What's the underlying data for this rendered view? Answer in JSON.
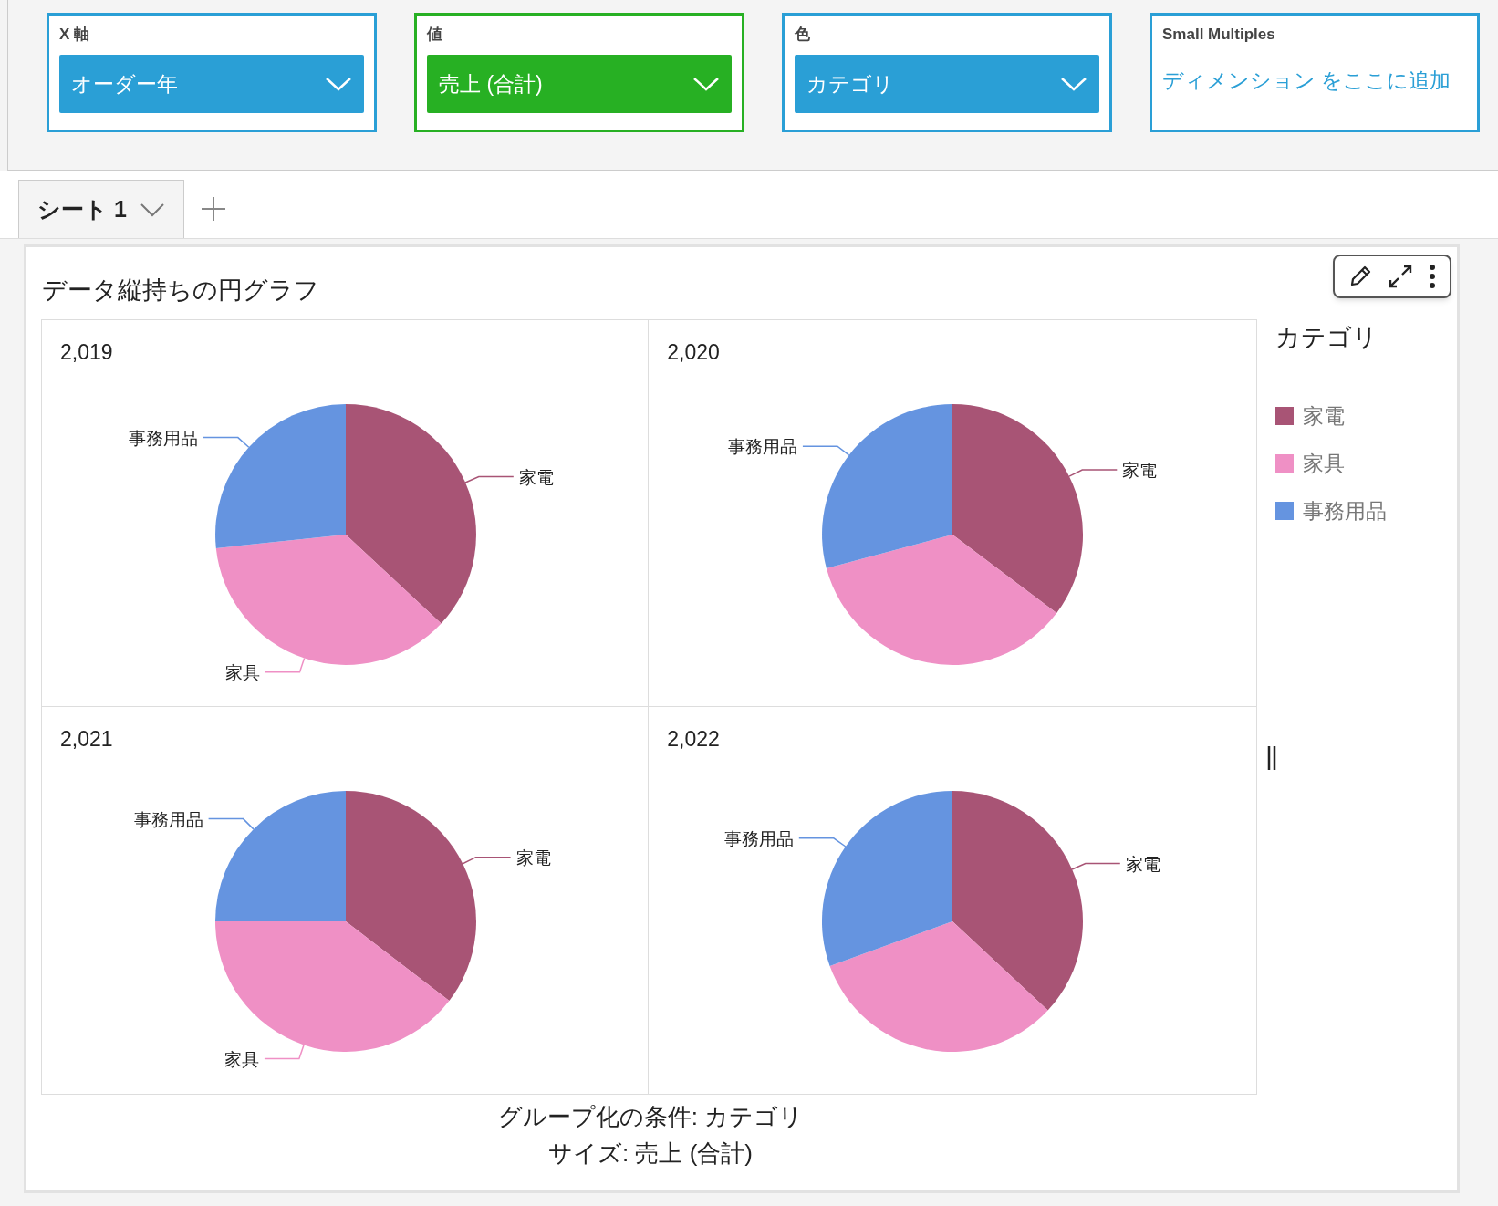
{
  "field_wells": [
    {
      "label": "X 軸",
      "kind": "dropdown",
      "value": "オーダー年",
      "color": "#2a9fd6"
    },
    {
      "label": "値",
      "kind": "dropdown",
      "value": "売上 (合計)",
      "color": "#27b023"
    },
    {
      "label": "色",
      "kind": "dropdown",
      "value": "カテゴリ",
      "color": "#2a9fd6"
    },
    {
      "label": "Small Multiples",
      "kind": "placeholder",
      "value": "ディメンション をここに追加",
      "color": "#2a9fd6"
    }
  ],
  "tabs": [
    {
      "label": "シート 1",
      "selected": true
    }
  ],
  "visual": {
    "title": "データ縦持ちの円グラフ",
    "panels": [
      {
        "title": "2,019",
        "slices": [
          {
            "kind": "labeled",
            "label": "家電"
          },
          {
            "kind": "labeled",
            "label": "家具"
          },
          {
            "kind": "labeled",
            "label": "事務用品"
          }
        ]
      },
      {
        "title": "2,020",
        "slices": [
          {
            "kind": "labeled",
            "label": "家電"
          },
          {
            "kind": "unlabeled"
          },
          {
            "kind": "labeled",
            "label": "事務用品"
          }
        ]
      },
      {
        "title": "2,021",
        "slices": [
          {
            "kind": "labeled",
            "label": "家電"
          },
          {
            "kind": "labeled",
            "label": "家具"
          },
          {
            "kind": "labeled",
            "label": "事務用品"
          }
        ]
      },
      {
        "title": "2,022",
        "slices": [
          {
            "kind": "labeled",
            "label": "家電"
          },
          {
            "kind": "unlabeled"
          },
          {
            "kind": "labeled",
            "label": "事務用品"
          }
        ]
      }
    ],
    "legend": {
      "title": "カテゴリ",
      "items": [
        {
          "label": "家電",
          "color": "#a85475"
        },
        {
          "label": "家具",
          "color": "#ef90c5"
        },
        {
          "label": "事務用品",
          "color": "#6594e0"
        }
      ]
    },
    "footer": [
      "グループ化の条件: カテゴリ",
      "サイズ: 売上 (合計)"
    ]
  }
}
